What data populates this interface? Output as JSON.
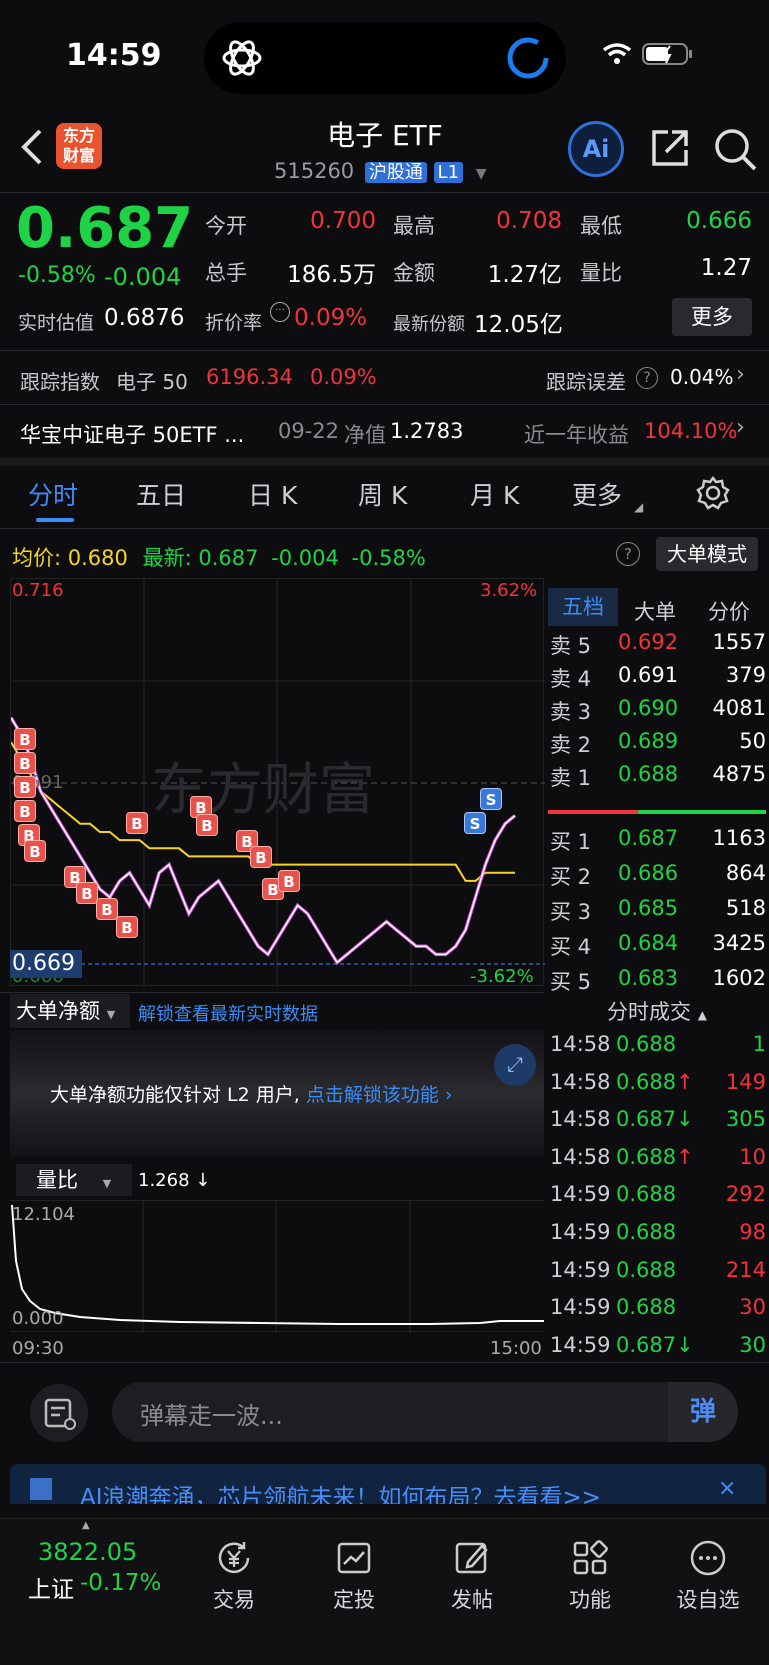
{
  "status_bar": {
    "time": "14:59"
  },
  "header": {
    "title": "电子 ETF",
    "code": "515260",
    "market": "沪股通",
    "level": "L1",
    "logo_line1": "东方",
    "logo_line2": "财富",
    "ai": "Ai"
  },
  "quote": {
    "price": "0.687",
    "change_pct": "-0.58%",
    "change": "-0.004",
    "open_label": "今开",
    "open": "0.700",
    "high_label": "最高",
    "high": "0.708",
    "low_label": "最低",
    "low": "0.666",
    "vol_label": "总手",
    "vol": "186.5万",
    "amount_label": "金额",
    "amount": "1.27亿",
    "vr_label": "量比",
    "vr": "1.27",
    "iopv_label": "实时估值",
    "iopv": "0.6876",
    "premium_label": "折价率",
    "premium": "0.09%",
    "shares_label": "最新份额",
    "shares": "12.05亿",
    "more": "更多"
  },
  "tracking": {
    "label": "跟踪指数",
    "index": "电子 50",
    "index_value": "6196.34",
    "index_pct": "0.09%",
    "error_label": "跟踪误差",
    "error": "0.04%"
  },
  "fund": {
    "name": "华宝中证电子 50ETF ...",
    "date": "09-22",
    "nav_label": "净值",
    "nav": "1.2783",
    "ret_label": "近一年收益",
    "ret": "104.10%"
  },
  "tabs": {
    "t1": "分时",
    "t2": "五日",
    "t3": "日 K",
    "t4": "周 K",
    "t5": "月 K",
    "t6": "更多"
  },
  "chart_info": {
    "avg_label": "均价:",
    "avg": "0.680",
    "last_label": "最新:",
    "last": "0.687",
    "chg": "-0.004",
    "pct": "-0.58%",
    "big_mode": "大单模式"
  },
  "chart_labels": {
    "top_price": "0.716",
    "top_pct": "3.62%",
    "bottom_pct": "-3.62%",
    "cursor_price": "0.669",
    "mid_price": "0.691",
    "low_price": "0.666",
    "watermark": "东方财富"
  },
  "orderbook_tabs": {
    "a": "五档",
    "b": "大单",
    "c": "分价"
  },
  "asks": [
    {
      "label": "卖 5",
      "price": "0.692",
      "vol": "1557",
      "color": "red"
    },
    {
      "label": "卖 4",
      "price": "0.691",
      "vol": "379",
      "color": "white"
    },
    {
      "label": "卖 3",
      "price": "0.690",
      "vol": "4081",
      "color": "green"
    },
    {
      "label": "卖 2",
      "price": "0.689",
      "vol": "50",
      "color": "green"
    },
    {
      "label": "卖 1",
      "price": "0.688",
      "vol": "4875",
      "color": "green"
    }
  ],
  "bids": [
    {
      "label": "买 1",
      "price": "0.687",
      "vol": "1163",
      "color": "green"
    },
    {
      "label": "买 2",
      "price": "0.686",
      "vol": "864",
      "color": "green"
    },
    {
      "label": "买 3",
      "price": "0.685",
      "vol": "518",
      "color": "green"
    },
    {
      "label": "买 4",
      "price": "0.684",
      "vol": "3425",
      "color": "green"
    },
    {
      "label": "买 5",
      "price": "0.683",
      "vol": "1602",
      "color": "green"
    }
  ],
  "big_order": {
    "label": "大单净额",
    "unlock": "解锁查看最新实时数据",
    "notice": "大单净额功能仅针对 L2 用户,",
    "notice_link": "点击解锁该功能"
  },
  "trades_title": "分时成交",
  "trades": [
    {
      "time": "14:58",
      "price": "0.688",
      "arrow": "",
      "vol": "1",
      "vc": "green"
    },
    {
      "time": "14:58",
      "price": "0.688",
      "arrow": "↑",
      "vol": "149",
      "vc": "red"
    },
    {
      "time": "14:58",
      "price": "0.687",
      "arrow": "↓",
      "vol": "305",
      "vc": "green"
    },
    {
      "time": "14:58",
      "price": "0.688",
      "arrow": "↑",
      "vol": "10",
      "vc": "red"
    },
    {
      "time": "14:59",
      "price": "0.688",
      "arrow": "",
      "vol": "292",
      "vc": "red"
    },
    {
      "time": "14:59",
      "price": "0.688",
      "arrow": "",
      "vol": "98",
      "vc": "red"
    },
    {
      "time": "14:59",
      "price": "0.688",
      "arrow": "",
      "vol": "214",
      "vc": "red"
    },
    {
      "time": "14:59",
      "price": "0.688",
      "arrow": "",
      "vol": "30",
      "vc": "red"
    },
    {
      "time": "14:59",
      "price": "0.687",
      "arrow": "↓",
      "vol": "30",
      "vc": "green"
    }
  ],
  "ratio": {
    "label": "量比",
    "value": "1.268 ↓",
    "max": "12.104",
    "min": "0.000",
    "start": "09:30",
    "end": "15:00"
  },
  "danmu": {
    "placeholder": "弹幕走一波...",
    "btn": "弹"
  },
  "banner": {
    "text": "AI浪潮奔涌，芯片领航未来！如何布局？去看看>>"
  },
  "bottom_nav": {
    "index_value": "3822.05",
    "index_name": "上证",
    "index_pct": "-0.17%",
    "n1": "交易",
    "n2": "定投",
    "n3": "发帖",
    "n4": "功能",
    "n5": "设自选"
  },
  "chart_data": {
    "type": "line",
    "title": "",
    "ylim": [
      0.666,
      0.716
    ],
    "series": [
      {
        "name": "最新",
        "values": [
          0.699,
          0.697,
          0.694,
          0.69,
          0.688,
          0.686,
          0.684,
          0.682,
          0.68,
          0.678,
          0.677,
          0.679,
          0.68,
          0.678,
          0.676,
          0.68,
          0.681,
          0.678,
          0.675,
          0.677,
          0.678,
          0.679,
          0.677,
          0.675,
          0.673,
          0.671,
          0.67,
          0.672,
          0.674,
          0.676,
          0.675,
          0.673,
          0.671,
          0.669,
          0.67,
          0.671,
          0.672,
          0.673,
          0.674,
          0.673,
          0.672,
          0.671,
          0.671,
          0.67,
          0.67,
          0.671,
          0.673,
          0.677,
          0.681,
          0.684,
          0.686,
          0.687
        ]
      },
      {
        "name": "均价",
        "values": [
          0.696,
          0.694,
          0.692,
          0.69,
          0.689,
          0.688,
          0.687,
          0.686,
          0.686,
          0.685,
          0.685,
          0.684,
          0.684,
          0.684,
          0.683,
          0.683,
          0.683,
          0.683,
          0.682,
          0.682,
          0.682,
          0.682,
          0.682,
          0.682,
          0.682,
          0.681,
          0.681,
          0.681,
          0.681,
          0.681,
          0.681,
          0.681,
          0.681,
          0.681,
          0.681,
          0.681,
          0.681,
          0.681,
          0.681,
          0.681,
          0.681,
          0.681,
          0.681,
          0.681,
          0.681,
          0.681,
          0.679,
          0.679,
          0.68,
          0.68,
          0.68,
          0.68
        ]
      }
    ]
  }
}
